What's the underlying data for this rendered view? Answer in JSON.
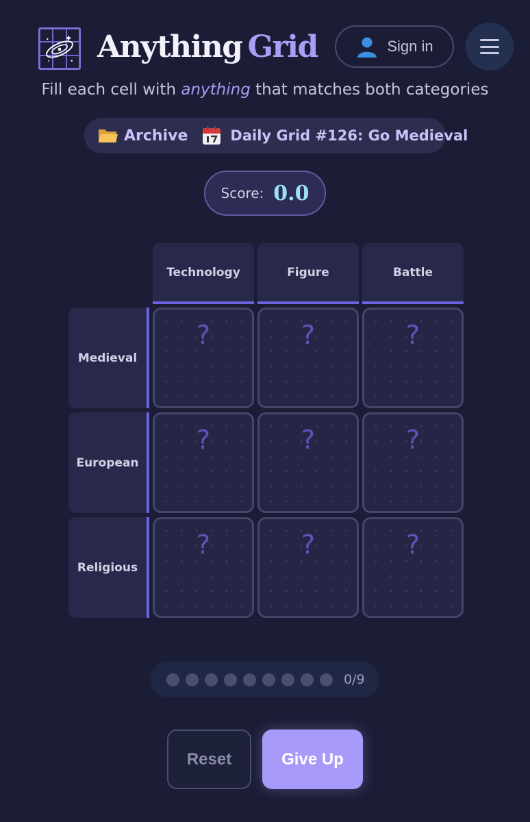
{
  "header": {
    "brand_word1": "Anything",
    "brand_word2": "Grid",
    "signin_label": "Sign in",
    "menu_icon": "hamburger-menu-icon"
  },
  "tagline": {
    "before": "Fill each cell with ",
    "emphasis": "anything",
    "after": " that matches both categories"
  },
  "info": {
    "archive_label": "Archive",
    "daily_label": "Daily Grid #126: Go Medieval"
  },
  "score": {
    "label": "Score:",
    "value": "0.0"
  },
  "grid": {
    "columns": [
      "Technology",
      "Figure",
      "Battle"
    ],
    "rows": [
      "Medieval",
      "European",
      "Religious"
    ],
    "cells": [
      [
        "?",
        "?",
        "?"
      ],
      [
        "?",
        "?",
        "?"
      ],
      [
        "?",
        "?",
        "?"
      ]
    ]
  },
  "progress": {
    "filled": 0,
    "total": 9,
    "label": "0/9"
  },
  "actions": {
    "reset_label": "Reset",
    "give_up_label": "Give Up"
  },
  "colors": {
    "background": "#1b1d36",
    "accent": "#a79ef5",
    "header_underline": "#6c63e3",
    "score_value": "#9ee0f8"
  }
}
